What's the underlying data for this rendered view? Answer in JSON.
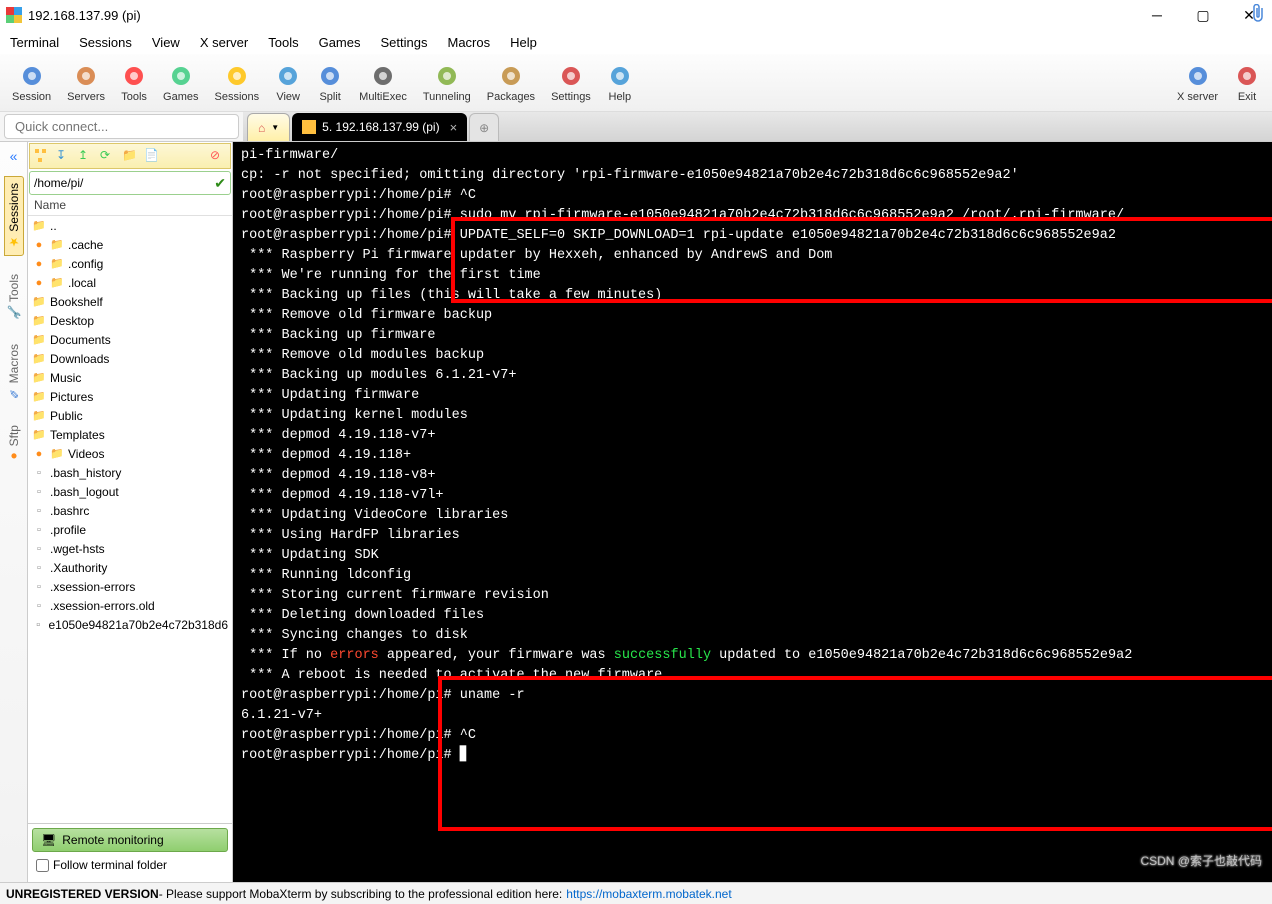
{
  "window": {
    "title": "192.168.137.99 (pi)"
  },
  "menu": [
    "Terminal",
    "Sessions",
    "View",
    "X server",
    "Tools",
    "Games",
    "Settings",
    "Macros",
    "Help"
  ],
  "toolbar": {
    "items": [
      {
        "id": "session",
        "label": "Session",
        "color": "#3a7bd5"
      },
      {
        "id": "servers",
        "label": "Servers",
        "color": "#d57a3a"
      },
      {
        "id": "tools",
        "label": "Tools",
        "color": "#ff3333"
      },
      {
        "id": "games",
        "label": "Games",
        "color": "#3acb7f"
      },
      {
        "id": "sessions",
        "label": "Sessions",
        "color": "#ffc107"
      },
      {
        "id": "view",
        "label": "View",
        "color": "#3a94d5"
      },
      {
        "id": "split",
        "label": "Split",
        "color": "#3a7bd5"
      },
      {
        "id": "multiexec",
        "label": "MultiExec",
        "color": "#555"
      },
      {
        "id": "tunneling",
        "label": "Tunneling",
        "color": "#7fae3a"
      },
      {
        "id": "packages",
        "label": "Packages",
        "color": "#c08b3a"
      },
      {
        "id": "settings",
        "label": "Settings",
        "color": "#d53a3a"
      },
      {
        "id": "help",
        "label": "Help",
        "color": "#3a94d5"
      }
    ],
    "right": [
      {
        "id": "xserver",
        "label": "X server",
        "color": "#3a7bd5"
      },
      {
        "id": "exit",
        "label": "Exit",
        "color": "#d53a3a"
      }
    ]
  },
  "quick_connect_placeholder": "Quick connect...",
  "tabs": {
    "session_label": "5. 192.168.137.99 (pi)"
  },
  "side_tabs": [
    "Sessions",
    "Tools",
    "Macros",
    "Sftp"
  ],
  "sftp": {
    "path": "/home/pi/",
    "header": "Name",
    "files": [
      {
        "n": "..",
        "t": "up"
      },
      {
        "n": ".cache",
        "t": "folder"
      },
      {
        "n": ".config",
        "t": "folder"
      },
      {
        "n": ".local",
        "t": "folder"
      },
      {
        "n": "Bookshelf",
        "t": "folder"
      },
      {
        "n": "Desktop",
        "t": "folder"
      },
      {
        "n": "Documents",
        "t": "folder"
      },
      {
        "n": "Downloads",
        "t": "folder"
      },
      {
        "n": "Music",
        "t": "folder"
      },
      {
        "n": "Pictures",
        "t": "folder"
      },
      {
        "n": "Public",
        "t": "folder"
      },
      {
        "n": "Templates",
        "t": "folder"
      },
      {
        "n": "Videos",
        "t": "folder"
      },
      {
        "n": ".bash_history",
        "t": "file"
      },
      {
        "n": ".bash_logout",
        "t": "file"
      },
      {
        "n": ".bashrc",
        "t": "file"
      },
      {
        "n": ".profile",
        "t": "file"
      },
      {
        "n": ".wget-hsts",
        "t": "file"
      },
      {
        "n": ".Xauthority",
        "t": "file"
      },
      {
        "n": ".xsession-errors",
        "t": "file"
      },
      {
        "n": ".xsession-errors.old",
        "t": "file"
      },
      {
        "n": "e1050e94821a70b2e4c72b318d6",
        "t": "file"
      }
    ],
    "remote_monitor": "Remote monitoring",
    "follow_label": "Follow terminal folder"
  },
  "terminal": {
    "lines": [
      {
        "t": "pi-firmware/"
      },
      {
        "t": "cp: -r not specified; omitting directory 'rpi-firmware-e1050e94821a70b2e4c72b318d6c6c968552e9a2'"
      },
      {
        "t": "root@raspberrypi:/home/pi# ^C"
      },
      {
        "t": "root@raspberrypi:/home/pi# sudo mv rpi-firmware-e1050e94821a70b2e4c72b318d6c6c968552e9a2 /root/.rpi-firmware/"
      },
      {
        "t": "root@raspberrypi:/home/pi# UPDATE_SELF=0 SKIP_DOWNLOAD=1 rpi-update e1050e94821a70b2e4c72b318d6c6c968552e9a2"
      },
      {
        "t": " *** Raspberry Pi firmware updater by Hexxeh, enhanced by AndrewS and Dom"
      },
      {
        "t": " *** We're running for the first time"
      },
      {
        "t": " *** Backing up files (this will take a few minutes)"
      },
      {
        "t": " *** Remove old firmware backup"
      },
      {
        "t": " *** Backing up firmware"
      },
      {
        "t": " *** Remove old modules backup"
      },
      {
        "t": " *** Backing up modules 6.1.21-v7+"
      },
      {
        "t": " *** Updating firmware"
      },
      {
        "t": " *** Updating kernel modules"
      },
      {
        "t": " *** depmod 4.19.118-v7+"
      },
      {
        "t": " *** depmod 4.19.118+"
      },
      {
        "t": " *** depmod 4.19.118-v8+"
      },
      {
        "t": " *** depmod 4.19.118-v7l+"
      },
      {
        "t": " *** Updating VideoCore libraries"
      },
      {
        "t": " *** Using HardFP libraries"
      },
      {
        "t": " *** Updating SDK"
      },
      {
        "t": " *** Running ldconfig"
      },
      {
        "t": " *** Storing current firmware revision"
      },
      {
        "t": " *** Deleting downloaded files"
      },
      {
        "t": " *** Syncing changes to disk"
      },
      {
        "p": [
          " *** If no ",
          "errors",
          " appeared, your firmware was ",
          "successfully",
          " updated to e1050e94821a70b2e4c72b318d6c6c968552e9a2"
        ],
        "c": [
          "",
          "hlred",
          "",
          "hlgreen",
          ""
        ]
      },
      {
        "t": " *** A reboot is needed to activate the new firmware"
      },
      {
        "t": "root@raspberrypi:/home/pi# uname -r"
      },
      {
        "t": "6.1.21-v7+"
      },
      {
        "t": "root@raspberrypi:/home/pi# ^C"
      },
      {
        "t": "root@raspberrypi:/home/pi# ▋"
      }
    ]
  },
  "status": {
    "unreg": "UNREGISTERED VERSION",
    "msg": "  -  Please support MobaXterm by subscribing to the professional edition here:",
    "link": "https://mobaxterm.mobatek.net"
  },
  "watermark": "CSDN @索子也敲代码"
}
